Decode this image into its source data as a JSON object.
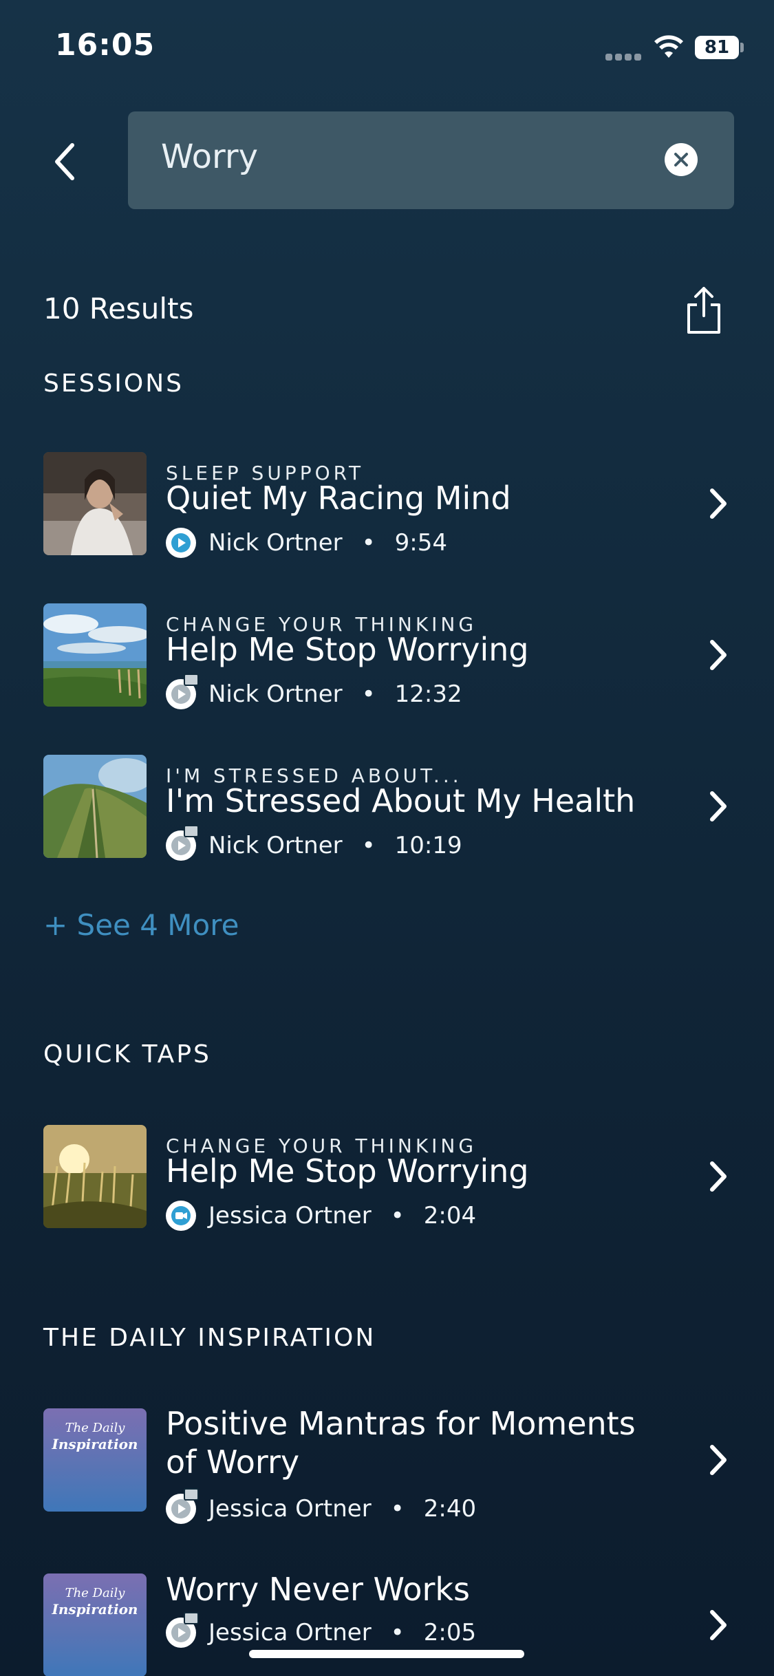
{
  "status_bar": {
    "time": "16:05",
    "battery": "81"
  },
  "search": {
    "query": "Worry"
  },
  "results": {
    "count_label": "10 Results"
  },
  "sections": {
    "sessions": {
      "heading": "SESSIONS",
      "items": [
        {
          "category": "SLEEP SUPPORT",
          "title": "Quiet My Racing Mind",
          "author": "Nick Ortner",
          "duration": "9:54",
          "locked": false,
          "icon": "play-icon"
        },
        {
          "category": "CHANGE YOUR THINKING",
          "title": "Help Me Stop Worrying",
          "author": "Nick Ortner",
          "duration": "12:32",
          "locked": true,
          "icon": "play-icon"
        },
        {
          "category": "I'M STRESSED ABOUT...",
          "title": "I'm Stressed About My Health",
          "author": "Nick Ortner",
          "duration": "10:19",
          "locked": true,
          "icon": "play-icon"
        }
      ],
      "see_more": "+ See 4 More"
    },
    "quick_taps": {
      "heading": "QUICK TAPS",
      "items": [
        {
          "category": "CHANGE YOUR THINKING",
          "title": "Help Me Stop Worrying",
          "author": "Jessica Ortner",
          "duration": "2:04",
          "locked": false,
          "icon": "video-icon"
        }
      ]
    },
    "daily_inspiration": {
      "heading": "THE DAILY INSPIRATION",
      "thumb_label_1": "The Daily",
      "thumb_label_2": "Inspiration",
      "items": [
        {
          "title_line1": "Positive Mantras for Moments",
          "title_line2": "of Worry",
          "author": "Jessica Ortner",
          "duration": "2:40",
          "locked": true,
          "icon": "play-icon"
        },
        {
          "title": "Worry Never Works",
          "author": "Jessica Ortner",
          "duration": "2:05",
          "locked": true,
          "icon": "play-icon"
        }
      ]
    }
  },
  "colors": {
    "accent": "#3f8fc0",
    "search_bg": "#3e5866",
    "play_icon": "#2f9fd3"
  }
}
